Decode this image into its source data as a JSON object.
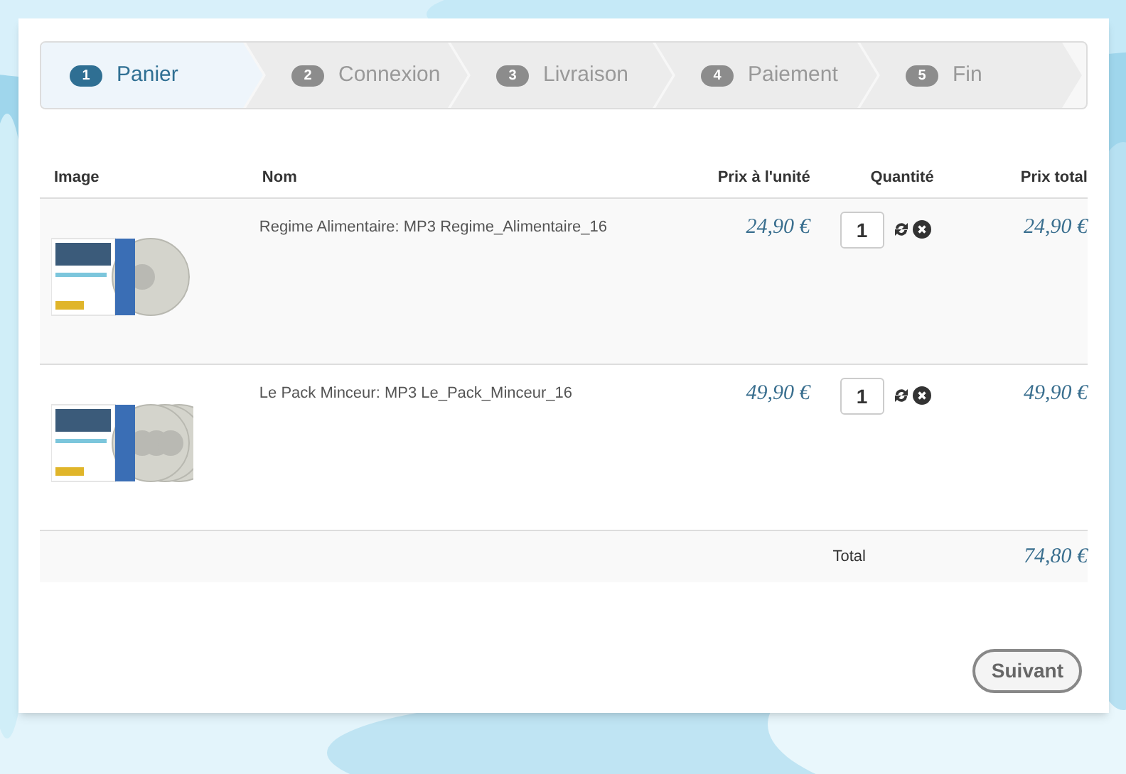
{
  "steps": [
    {
      "number": "1",
      "label": "Panier",
      "selected": true
    },
    {
      "number": "2",
      "label": "Connexion",
      "selected": false
    },
    {
      "number": "3",
      "label": "Livraison",
      "selected": false
    },
    {
      "number": "4",
      "label": "Paiement",
      "selected": false
    },
    {
      "number": "5",
      "label": "Fin",
      "selected": false
    }
  ],
  "table": {
    "columns": [
      "Image",
      "Nom",
      "Prix à l'unité",
      "Quantité",
      "Prix total"
    ],
    "rows": [
      {
        "name": "Regime Alimentaire: MP3 Regime_Alimentaire_16",
        "unit_price": "24,90 €",
        "quantity": "1",
        "total_price": "24,90 €"
      },
      {
        "name": "Le Pack Minceur: MP3 Le_Pack_Minceur_16",
        "unit_price": "49,90 €",
        "quantity": "1",
        "total_price": "49,90 €"
      }
    ],
    "total": {
      "label": "Total",
      "value": "74,80 €"
    }
  },
  "next_button": "Suivant"
}
